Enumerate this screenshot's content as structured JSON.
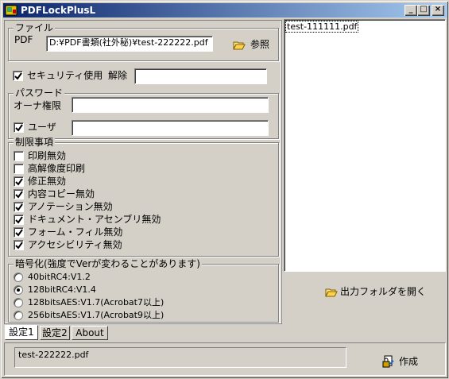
{
  "window": {
    "title": "PDFLockPlusL",
    "minimize_label": "_",
    "maximize_label": "□",
    "close_label": "×"
  },
  "file_group": {
    "label": "ファイル",
    "pdf_label": "PDF",
    "pdf_path": "D:¥PDF書類(社外秘)¥test-222222.pdf",
    "browse_button": "参照"
  },
  "security": {
    "use_security_label": "セキュリティ使用",
    "use_security_checked": true,
    "unlock_label": "解除",
    "unlock_value": ""
  },
  "password_group": {
    "label": "パスワード",
    "owner_label": "オーナ権限",
    "owner_value": "",
    "user_label": "ユーザ",
    "user_checked": true,
    "user_value": ""
  },
  "restrictions_group": {
    "label": "制限事項",
    "items": [
      {
        "label": "印刷無効",
        "checked": false
      },
      {
        "label": "高解像度印刷",
        "checked": false
      },
      {
        "label": "修正無効",
        "checked": true
      },
      {
        "label": "内容コピー無効",
        "checked": true
      },
      {
        "label": "アノテーション無効",
        "checked": true
      },
      {
        "label": "ドキュメント・アセンブリ無効",
        "checked": true
      },
      {
        "label": "フォーム・フィル無効",
        "checked": true
      },
      {
        "label": "アクセシビリティ無効",
        "checked": true
      }
    ]
  },
  "encryption_group": {
    "label": "暗号化(強度でVerが変わることがあります)",
    "options": [
      {
        "label": "40bitRC4:V1.2",
        "selected": false
      },
      {
        "label": "128bitRC4:V1.4",
        "selected": true
      },
      {
        "label": "128bitsAES:V1.7(Acrobat7以上)",
        "selected": false
      },
      {
        "label": "256bitsAES:V1.7(Acrobat9以上)",
        "selected": false
      }
    ]
  },
  "tabs": [
    {
      "label": "設定1",
      "active": true
    },
    {
      "label": "設定2",
      "active": false
    },
    {
      "label": "About",
      "active": false
    }
  ],
  "file_list": {
    "items": [
      "test-111111.pdf"
    ]
  },
  "open_output_folder_button": "出力フォルダを開く",
  "status": {
    "current_file": "test-222222.pdf"
  },
  "create_button": "作成",
  "colors": {
    "face": "#d4d0c8",
    "title_start": "#0a246a",
    "title_end": "#a6caf0"
  }
}
